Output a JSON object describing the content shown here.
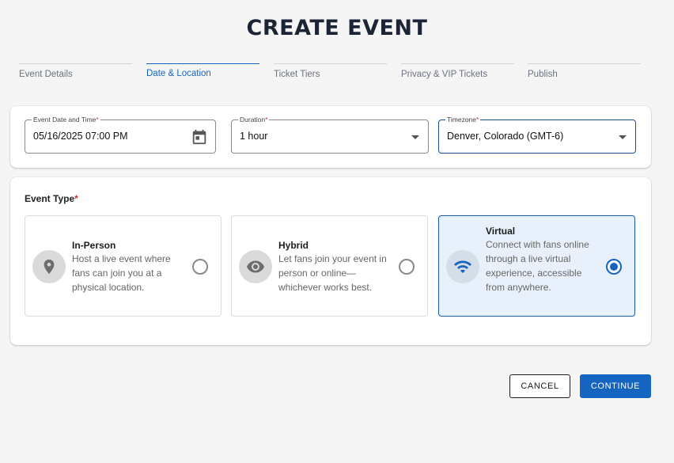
{
  "page": {
    "title": "CREATE EVENT"
  },
  "steps": [
    {
      "label": "Event Details",
      "active": false
    },
    {
      "label": "Date & Location",
      "active": true
    },
    {
      "label": "Ticket Tiers",
      "active": false
    },
    {
      "label": "Privacy & VIP Tickets",
      "active": false
    },
    {
      "label": "Publish",
      "active": false
    }
  ],
  "fields": {
    "datetime": {
      "label": "Event Date and Time",
      "required_mark": "*",
      "value": "05/16/2025 07:00 PM",
      "icon": "calendar-icon"
    },
    "duration": {
      "label": "Duration",
      "required_mark": "*",
      "value": "1 hour"
    },
    "timezone": {
      "label": "Timezone",
      "required_mark": "*",
      "value": "Denver, Colorado (GMT-6)"
    }
  },
  "event_type": {
    "label": "Event Type",
    "required_mark": "*",
    "options": [
      {
        "title": "In-Person",
        "description": "Host a live event where fans can join you at a physical location.",
        "icon": "location-pin-icon",
        "selected": false
      },
      {
        "title": "Hybrid",
        "description": "Let fans join your event in person or online—whichever works best.",
        "icon": "eye-icon",
        "selected": false
      },
      {
        "title": "Virtual",
        "description": "Connect with fans online through a live virtual experience, accessible from anywhere.",
        "icon": "wifi-icon",
        "selected": true
      }
    ]
  },
  "actions": {
    "cancel_label": "CANCEL",
    "continue_label": "CONTINUE"
  },
  "colors": {
    "primary": "#1565c0",
    "selected_bg": "#e8f1fb",
    "required": "#d32f2f",
    "title": "#1c2536"
  }
}
